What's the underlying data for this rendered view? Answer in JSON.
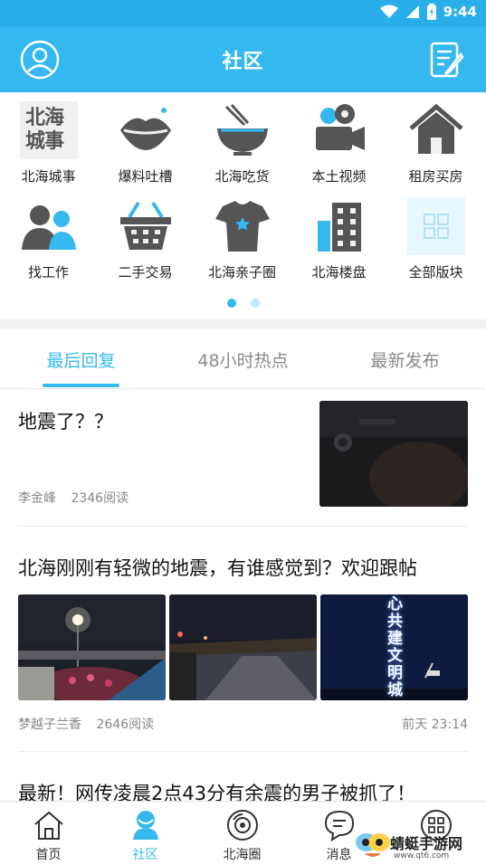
{
  "status_bar": {
    "time": "9:44"
  },
  "header": {
    "title": "社区"
  },
  "categories": [
    {
      "label": "北海城事",
      "icon": "beihai-city-icon"
    },
    {
      "label": "爆料吐槽",
      "icon": "lips-icon"
    },
    {
      "label": "北海吃货",
      "icon": "noodle-bowl-icon"
    },
    {
      "label": "本土视频",
      "icon": "video-camera-icon"
    },
    {
      "label": "租房买房",
      "icon": "house-icon"
    },
    {
      "label": "找工作",
      "icon": "people-icon"
    },
    {
      "label": "二手交易",
      "icon": "basket-icon"
    },
    {
      "label": "北海亲子圈",
      "icon": "baby-clothes-icon"
    },
    {
      "label": "北海楼盘",
      "icon": "buildings-icon"
    },
    {
      "label": "全部版块",
      "icon": "grid-icon"
    }
  ],
  "city_icon_text": [
    "北海",
    "城事"
  ],
  "tabs": [
    {
      "label": "最后回复",
      "active": true
    },
    {
      "label": "48小时热点",
      "active": false
    },
    {
      "label": "最新发布",
      "active": false
    }
  ],
  "posts": [
    {
      "title": "地震了？？",
      "author": "李金峰",
      "reads": "2346阅读"
    },
    {
      "title": "北海刚刚有轻微的地震，有谁感觉到？欢迎跟帖",
      "author": "梦越子兰香",
      "reads": "2646阅读",
      "time": "前天 23:14",
      "sign_text": "心共建文明城"
    },
    {
      "title": "最新！网传凌晨2点43分有余震的男子被抓了！"
    }
  ],
  "bottom_nav": [
    {
      "label": "首页",
      "icon": "home-icon",
      "active": false
    },
    {
      "label": "社区",
      "icon": "community-icon",
      "active": true
    },
    {
      "label": "北海圈",
      "icon": "circle-icon",
      "active": false
    },
    {
      "label": "消息",
      "icon": "message-icon",
      "active": false
    },
    {
      "label": "",
      "icon": "apps-icon",
      "active": false
    }
  ],
  "watermark": {
    "text": "蜻蜓手游网",
    "url": "www.qt6.com"
  },
  "colors": {
    "primary": "#35b8f0",
    "status": "#2aaeea"
  }
}
